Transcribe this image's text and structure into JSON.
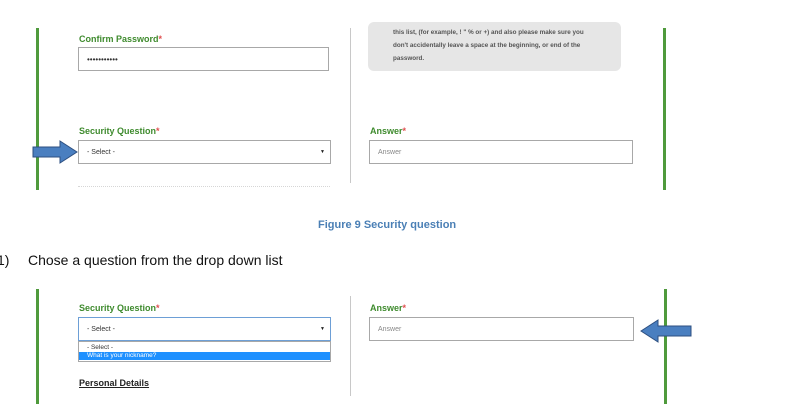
{
  "top_form": {
    "confirm_password_label": "Confirm Password",
    "required_mark": "*",
    "confirm_password_value": "•••••••••••",
    "info_lines": [
      "this list, (for example, ! \" % or +) and also please make sure you",
      "don't accidentally leave a space at the beginning, or end of the",
      "password."
    ],
    "security_question_label": "Security Question",
    "security_question_selected": "- Select -",
    "answer_label": "Answer",
    "answer_placeholder": "Answer"
  },
  "figure_caption": "Figure 9 Security question",
  "step": {
    "number": "1)",
    "text": "Chose a question from the drop down list"
  },
  "bottom_form": {
    "security_question_label": "Security Question",
    "required_mark": "*",
    "security_question_selected": "- Select -",
    "dropdown_options": [
      "- Select -",
      "What is your nickname?"
    ],
    "answer_label": "Answer",
    "answer_placeholder": "Answer",
    "personal_details_heading": "Personal Details"
  },
  "colors": {
    "green_accent": "#3f8b2e",
    "border_green": "#4f9a3c",
    "arrow_blue": "#4a7fc0",
    "caption_blue": "#4a7fb5",
    "highlight_blue": "#1e90ff"
  },
  "icons": [
    "arrow-right-icon",
    "arrow-left-icon",
    "dropdown-caret-icon"
  ]
}
